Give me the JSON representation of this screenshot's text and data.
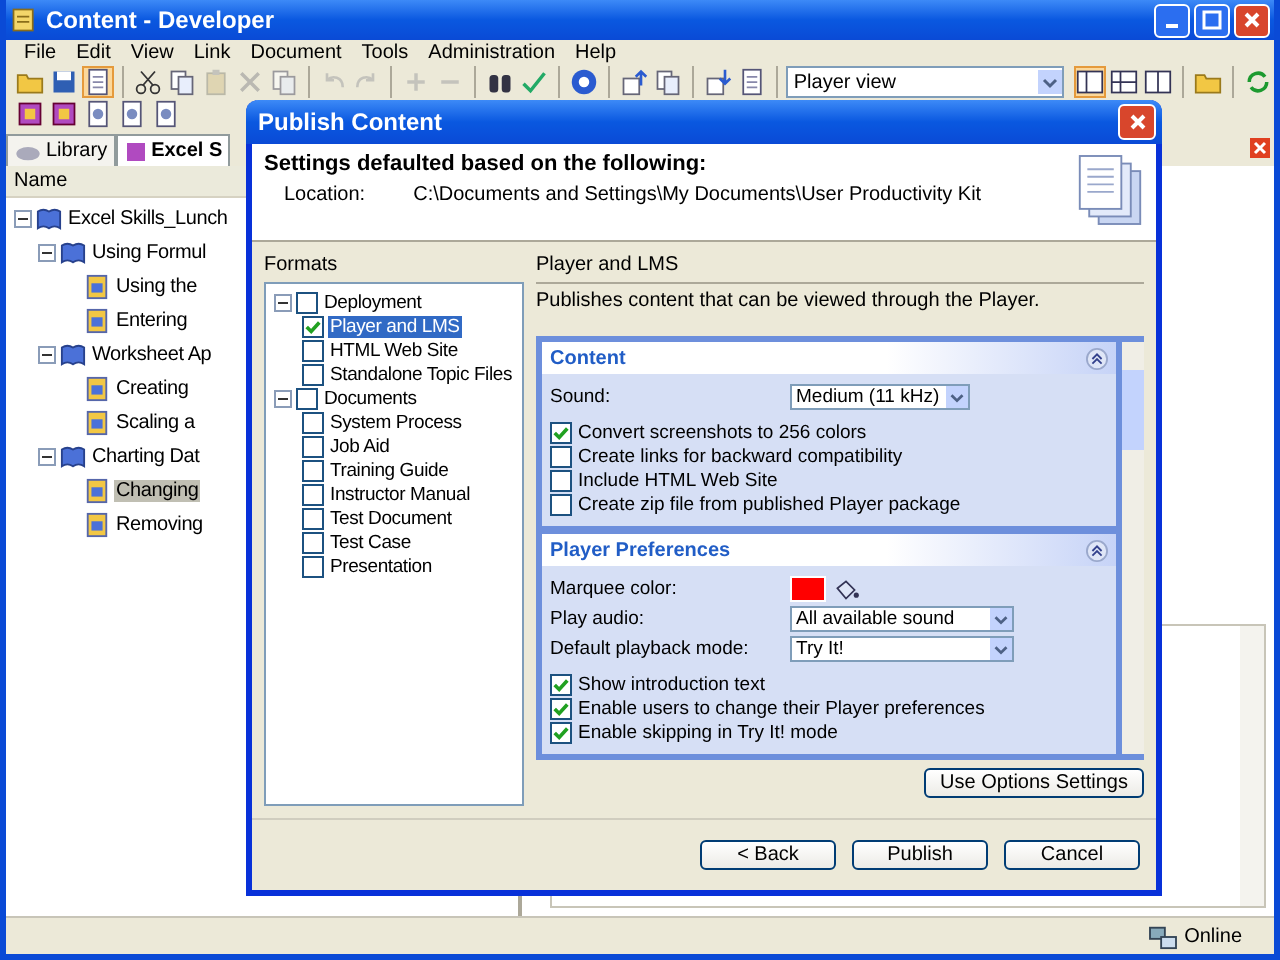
{
  "window": {
    "title": "Content - Developer"
  },
  "menu": [
    "File",
    "Edit",
    "View",
    "Link",
    "Document",
    "Tools",
    "Administration",
    "Help"
  ],
  "toolbar": {
    "view_select": "Player view"
  },
  "tabs": [
    {
      "label": "Library",
      "selected": false
    },
    {
      "label": "Excel S",
      "selected": true
    }
  ],
  "tree": {
    "column": "Name",
    "items": [
      {
        "label": "Excel Skills_Lunch",
        "expanded": true,
        "children": [
          {
            "label": "Using Formul",
            "expanded": true,
            "children": [
              {
                "label": "Using the",
                "selected": false
              },
              {
                "label": "Entering",
                "selected": false
              }
            ]
          },
          {
            "label": "Worksheet Ap",
            "expanded": true,
            "children": [
              {
                "label": "Creating",
                "selected": false
              },
              {
                "label": "Scaling a",
                "selected": false
              }
            ]
          },
          {
            "label": "Charting Dat",
            "expanded": true,
            "children": [
              {
                "label": "Changing",
                "selected": true
              },
              {
                "label": "Removing",
                "selected": false
              }
            ]
          }
        ]
      }
    ]
  },
  "dialog": {
    "title": "Publish Content",
    "heading": "Settings defaulted based on the following:",
    "location_label": "Location:",
    "location": "C:\\Documents and Settings\\My Documents\\User Productivity Kit",
    "formats_label": "Formats",
    "formats": [
      {
        "label": "Deployment",
        "expanded": true,
        "checked": false,
        "children": [
          {
            "label": "Player and LMS",
            "checked": true,
            "selected": true
          },
          {
            "label": "HTML Web Site",
            "checked": false,
            "selected": false
          },
          {
            "label": "Standalone Topic Files",
            "checked": false,
            "selected": false
          }
        ]
      },
      {
        "label": "Documents",
        "expanded": true,
        "checked": false,
        "children": [
          {
            "label": "System Process",
            "checked": false,
            "selected": false
          },
          {
            "label": "Job Aid",
            "checked": false,
            "selected": false
          },
          {
            "label": "Training Guide",
            "checked": false,
            "selected": false
          },
          {
            "label": "Instructor Manual",
            "checked": false,
            "selected": false
          },
          {
            "label": "Test Document",
            "checked": false,
            "selected": false
          },
          {
            "label": "Test Case",
            "checked": false,
            "selected": false
          },
          {
            "label": "Presentation",
            "checked": false,
            "selected": false
          }
        ]
      }
    ],
    "format_title": "Player and LMS",
    "format_description": "Publishes content that can be viewed through the Player.",
    "sections": [
      {
        "title": "Content",
        "expanded": true,
        "fields": [
          {
            "kind": "select",
            "label": "Sound:",
            "value": "Medium (11 kHz)"
          }
        ],
        "checkboxes": [
          {
            "label": "Convert screenshots to 256 colors",
            "checked": true
          },
          {
            "label": "Create links for backward compatibility",
            "checked": false
          },
          {
            "label": "Include HTML Web Site",
            "checked": false
          },
          {
            "label": "Create zip file from published Player package",
            "checked": false
          }
        ]
      },
      {
        "title": "Player Preferences",
        "expanded": true,
        "fields": [
          {
            "kind": "color",
            "label": "Marquee color:",
            "color": "#ff0000"
          },
          {
            "kind": "select",
            "label": "Play audio:",
            "value": "All available sound"
          },
          {
            "kind": "select",
            "label": "Default playback mode:",
            "value": "Try It!"
          }
        ],
        "checkboxes": [
          {
            "label": "Show introduction text",
            "checked": true
          },
          {
            "label": "Enable users to change their Player preferences",
            "checked": true
          },
          {
            "label": "Enable skipping in Try It! mode",
            "checked": true
          }
        ]
      }
    ],
    "options_button": "Use Options Settings",
    "buttons": [
      "< Back",
      "Publish",
      "Cancel"
    ]
  },
  "status_bar": {
    "text": "Online"
  }
}
